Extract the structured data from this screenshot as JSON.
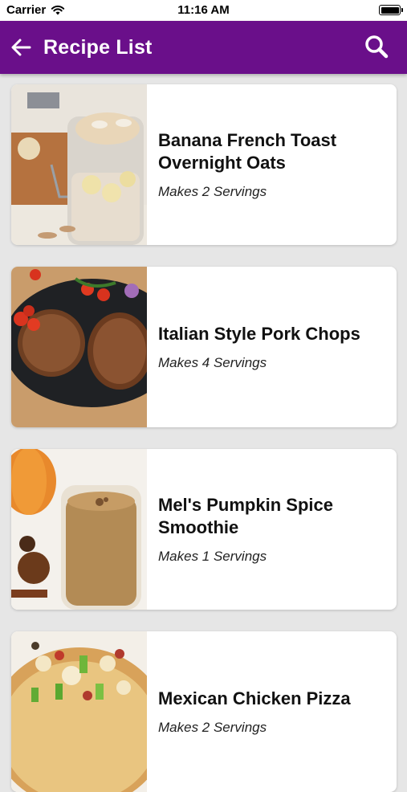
{
  "status_bar": {
    "carrier": "Carrier",
    "time": "11:16 AM"
  },
  "app_bar": {
    "title": "Recipe List",
    "back_icon": "arrow-left-icon",
    "search_icon": "search-icon",
    "color": "#6a0f8a"
  },
  "recipes": [
    {
      "name": "Banana French Toast Overnight Oats",
      "servings": "Makes 2 Servings"
    },
    {
      "name": "Italian Style Pork Chops",
      "servings": "Makes 4 Servings"
    },
    {
      "name": "Mel's Pumpkin Spice Smoothie",
      "servings": "Makes 1 Servings"
    },
    {
      "name": "Mexican Chicken Pizza",
      "servings": "Makes 2 Servings"
    }
  ]
}
